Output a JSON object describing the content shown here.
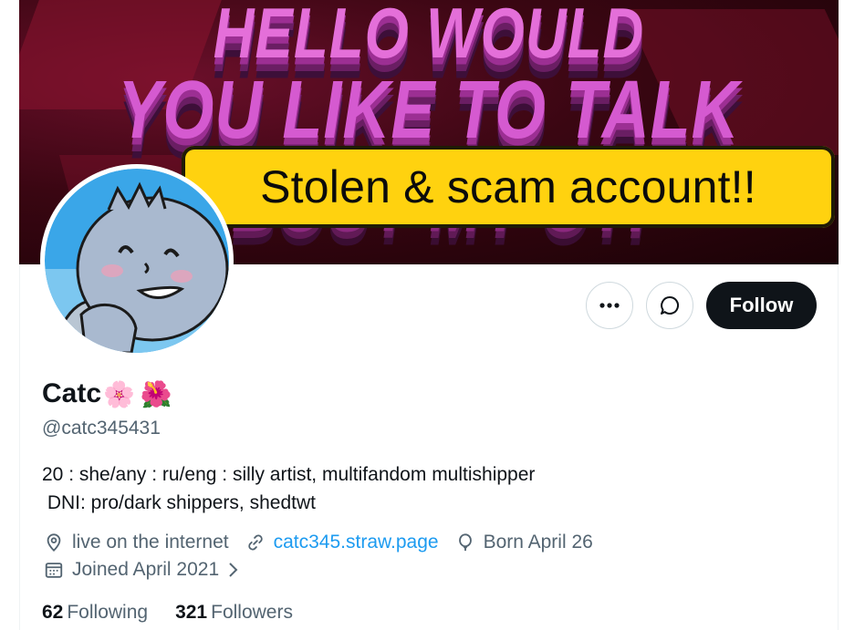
{
  "banner": {
    "text_lines": [
      "HELLO WOULD",
      "YOU LIKE TO TALK",
      "ABOUT MY OTP"
    ],
    "colors": {
      "background": "#3a0612",
      "text": "#e46fd9"
    }
  },
  "warning_label": "Stolen & scam account!!",
  "actions": {
    "more_icon": "more-horizontal-icon",
    "message_icon": "message-bubble-icon",
    "follow_label": "Follow"
  },
  "profile": {
    "name": "Catc",
    "name_emojis": [
      "🌸",
      "🌺"
    ],
    "handle": "@catc345431",
    "bio": "20 : she/any : ru/eng : silly artist, multifandom multishipper\n DNI: pro/dark shippers, shedtwt",
    "location": "live on the internet",
    "website": "catc345.straw.page",
    "birthday": "Born April 26",
    "joined": "Joined April 2021",
    "following_count": "62",
    "following_label": "Following",
    "followers_count": "321",
    "followers_label": "Followers"
  },
  "colors": {
    "accent": "#1d9bf0",
    "muted": "#536471",
    "sticker": "#ffd20f"
  }
}
